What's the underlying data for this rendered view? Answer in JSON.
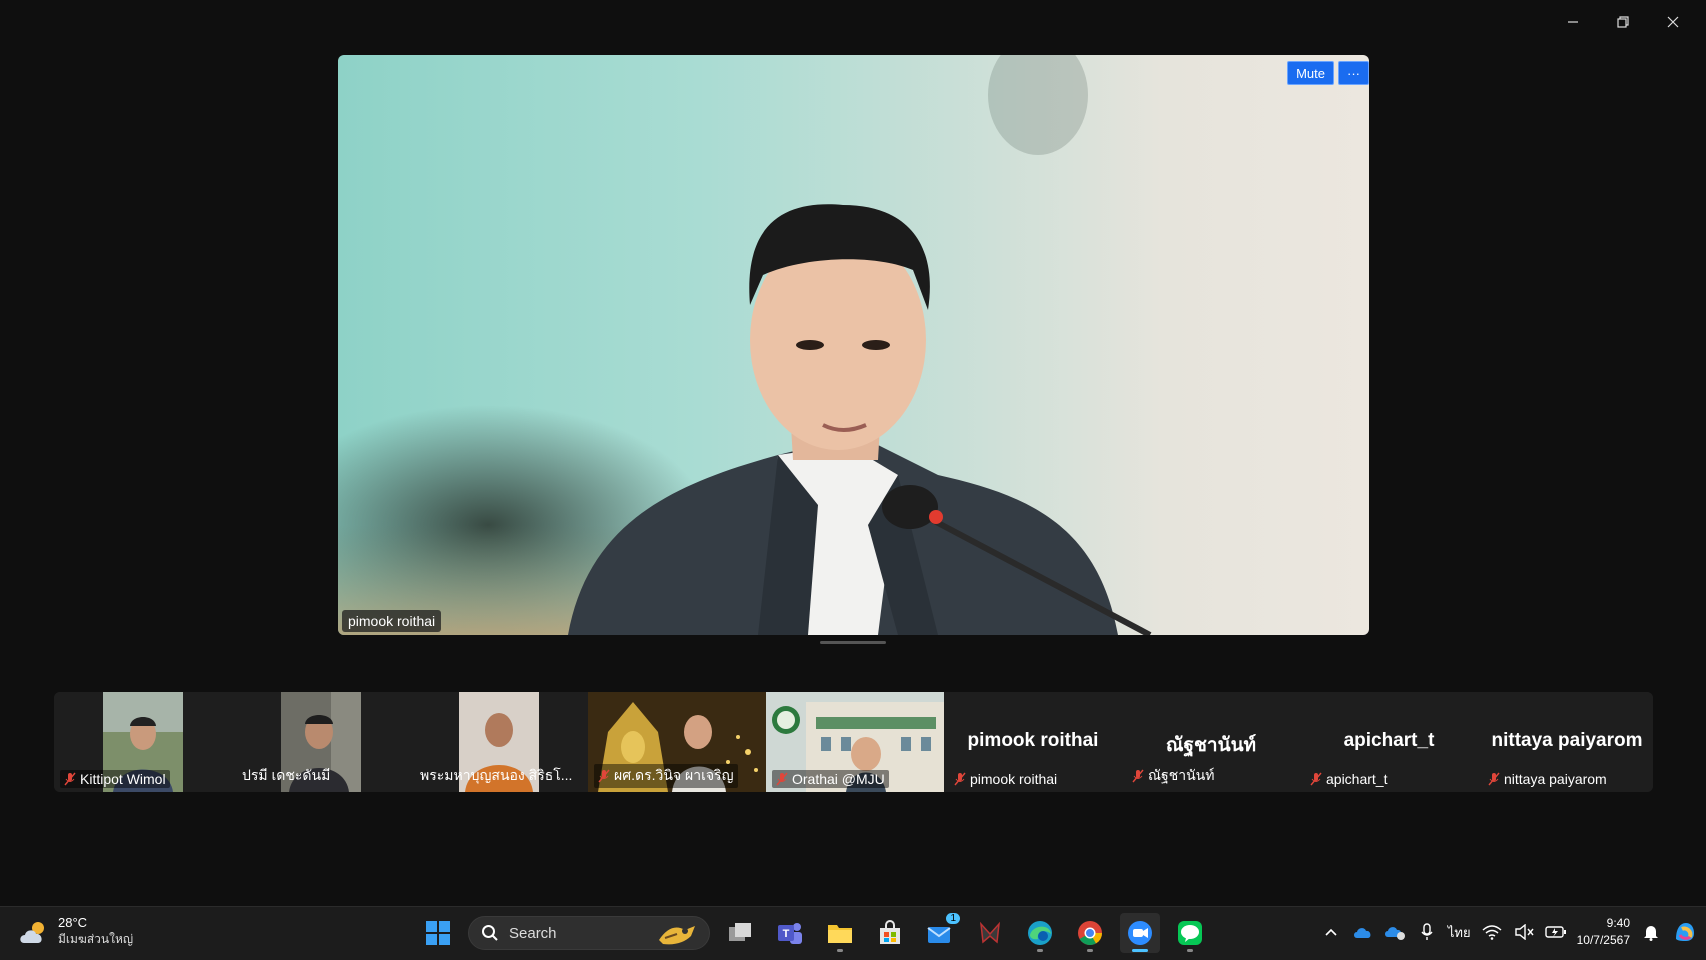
{
  "window": {
    "controls": [
      "minimize",
      "restore",
      "close"
    ]
  },
  "main_video": {
    "speaker_name": "pimook roithai",
    "mute_label": "Mute",
    "more_label": "···"
  },
  "participants": [
    {
      "name": "Kittipot Wimol",
      "muted": true,
      "video": true
    },
    {
      "name": "ปรมี เดชะดันมี",
      "muted": false,
      "video": true
    },
    {
      "name": "พระมหาบุญสนอง สิริธโ...",
      "muted": false,
      "video": true
    },
    {
      "name": "ผศ.ดร.วินิจ ผาเจริญ",
      "muted": true,
      "video": true
    },
    {
      "name": "Orathai @MJU",
      "muted": true,
      "video": true
    },
    {
      "name": "pimook roithai",
      "display": "pimook roithai",
      "muted": true,
      "video": false
    },
    {
      "name": "ณัฐชานันท์",
      "display": "ณัฐชานันท์",
      "muted": true,
      "video": false
    },
    {
      "name": "apichart_t",
      "display": "apichart_t",
      "muted": true,
      "video": false
    },
    {
      "name": "nittaya paiyarom",
      "display": "nittaya paiyarom",
      "muted": true,
      "video": false
    }
  ],
  "taskbar": {
    "weather_temp": "28°C",
    "weather_location": "มีเมฆส่วนใหญ่",
    "search_placeholder": "Search",
    "apps": [
      "start-icon",
      "task-view-icon",
      "teams-icon",
      "file-explorer-icon",
      "store-icon",
      "mail-icon",
      "game-icon",
      "edge-icon",
      "chrome-icon",
      "zoom-icon",
      "line-icon"
    ],
    "mail_badge": "1",
    "language": "ไทย",
    "time": "9:40",
    "date": "10/7/2567"
  },
  "colors": {
    "accent": "#1a6cf0",
    "taskbar_active": "#4cc2ff",
    "mic_off": "#e0463a"
  }
}
